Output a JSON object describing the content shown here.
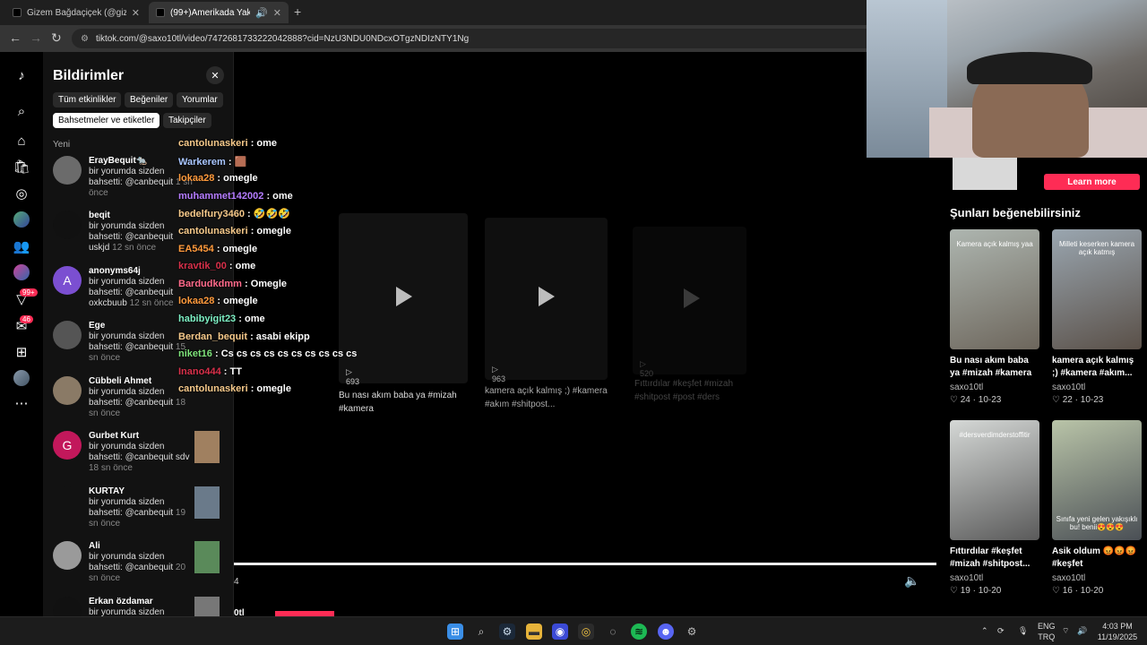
{
  "browser": {
    "tabs": [
      {
        "title": "Gizem Bağdaçiçek (@gizemsa..."
      },
      {
        "title": "(99+)Amerikada Yakışıklı Gö..."
      }
    ],
    "url": "tiktok.com/@saxo10tl/video/7472681733222042888?cid=NzU3NDU0NDcxOTgzNDIzNTY1Ng"
  },
  "leftnav": {
    "badge_messages": "46",
    "badge_inbox": "99+"
  },
  "notifications": {
    "title": "Bildirimler",
    "filters": [
      "Tüm etkinlikler",
      "Beğeniler",
      "Yorumlar",
      "Bahsetmeler ve etiketler",
      "Takipçiler"
    ],
    "section": "Yeni",
    "items": [
      {
        "name": "ErayBequit🐀",
        "body": "bir yorumda sizden bahsetti: @canbequit",
        "time": "1 sn önce",
        "initial": ""
      },
      {
        "name": "beqit",
        "body": "bir yorumda sizden bahsetti: @canbequit uskjd",
        "time": "12 sn önce",
        "initial": ""
      },
      {
        "name": "anonyms64j",
        "body": "bir yorumda sizden bahsetti: @canbequit oxkcbuub",
        "time": "12 sn önce",
        "initial": "A"
      },
      {
        "name": "Ege",
        "body": "bir yorumda sizden bahsetti: @canbequit",
        "time": "15 sn önce",
        "initial": ""
      },
      {
        "name": "Cübbeli Ahmet",
        "body": "bir yorumda sizden bahsetti: @canbequit",
        "time": "18 sn önce",
        "initial": ""
      },
      {
        "name": "Gurbet Kurt",
        "body": "bir yorumda sizden bahsetti: @canbequit sdv",
        "time": "18 sn önce",
        "initial": "G"
      },
      {
        "name": "KURTAY",
        "body": "bir yorumda sizden bahsetti: @canbequit",
        "time": "19 sn önce",
        "initial": ""
      },
      {
        "name": "Ali",
        "body": "bir yorumda sizden bahsetti: @canbequit",
        "time": "20 sn önce",
        "initial": ""
      },
      {
        "name": "Erkan özdamar",
        "body": "bir yorumda sizden",
        "time": "",
        "initial": ""
      }
    ]
  },
  "chat": [
    {
      "user": "cantolunaskeri",
      "msg": "ome",
      "color": "#f6c98a"
    },
    {
      "user": "Warkerem",
      "msg": "🟫",
      "color": "#a9c6ff"
    },
    {
      "user": "lokaa28",
      "msg": "omegle",
      "color": "#ff9a3c"
    },
    {
      "user": "muhammet142002",
      "msg": "ome",
      "color": "#b57cff"
    },
    {
      "user": "bedelfury3460",
      "msg": "🤣🤣🤣",
      "color": "#f6c98a"
    },
    {
      "user": "cantolunaskeri",
      "msg": "omegle",
      "color": "#f6c98a"
    },
    {
      "user": "EA5454",
      "msg": "omegle",
      "color": "#ff9a3c"
    },
    {
      "user": "kravtik_00",
      "msg": "ome",
      "color": "#d8304a"
    },
    {
      "user": "Bardudkdmm",
      "msg": "Omegle",
      "color": "#ff6a8a"
    },
    {
      "user": "lokaa28",
      "msg": "omegle",
      "color": "#ff9a3c"
    },
    {
      "user": "habibyigit23",
      "msg": "ome",
      "color": "#7df0c4"
    },
    {
      "user": "Berdan_bequit",
      "msg": "asabi ekipp",
      "color": "#f6c98a"
    },
    {
      "user": "niket16",
      "msg": "Cs cs cs cs cs cs cs cs cs cs",
      "color": "#7ee37a"
    },
    {
      "user": "Inano444",
      "msg": "TT",
      "color": "#d8304a"
    },
    {
      "user": "cantolunaskeri",
      "msg": "omegle",
      "color": "#f6c98a"
    }
  ],
  "video": {
    "cards": [
      {
        "views": "693",
        "caption": "Bu nası akım baba ya #mizah #kamera"
      },
      {
        "views": "963",
        "caption": "kamera açık kalmış ;) #kamera #akım #shitpost..."
      },
      {
        "views": "520",
        "caption": "Fıttırdılar #keşfet #mizah #shitpost #post #ders"
      }
    ],
    "time": "4",
    "bottom_text": "0tl"
  },
  "right": {
    "learn_more": "Learn more",
    "title": "Şunları beğenebilirsiniz",
    "cards": [
      {
        "overlay": "Kamera açık kalmış yaa",
        "caption": "Bu nası akım baba ya #mizah #kamera",
        "user": "saxo10tl",
        "likes": "24",
        "date": "10-23"
      },
      {
        "overlay": "Milleti keserken kamera açık katmış",
        "caption": "kamera açık kalmış ;) #kamera #akım...",
        "user": "saxo10tl",
        "likes": "22",
        "date": "10-23"
      },
      {
        "overlay": "#dersverdimderstoffitir",
        "caption": "Fıttırdılar #keşfet #mizah #shitpost...",
        "user": "saxo10tl",
        "likes": "19",
        "date": "10-20"
      },
      {
        "overlay": "Sınıfa yeni gelen yakışıklı bu! benii😍😍😍",
        "caption": "Asik oldum 😡😡😡 #keşfet",
        "user": "saxo10tl",
        "likes": "16",
        "date": "10-20"
      }
    ]
  },
  "taskbar": {
    "lang1": "ENG",
    "lang2": "TRQ",
    "time": "4:03 PM",
    "date": "11/19/2025"
  }
}
